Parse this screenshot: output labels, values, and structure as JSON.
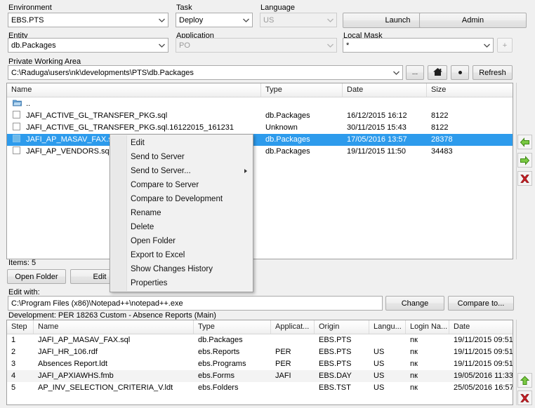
{
  "top_form": {
    "environment": {
      "label": "Environment",
      "value": "EBS.PTS"
    },
    "task": {
      "label": "Task",
      "value": "Deploy"
    },
    "language": {
      "label": "Language",
      "value": "US",
      "disabled": true
    },
    "launch_button": "Launch",
    "admin_button": "Admin",
    "entity": {
      "label": "Entity",
      "value": "db.Packages"
    },
    "application": {
      "label": "Application",
      "value": "PO",
      "disabled": true
    },
    "local_mask": {
      "label": "Local Mask",
      "value": "*"
    },
    "local_mask_add_button": "+",
    "private_working_area": {
      "label": "Private Working Area",
      "value": "C:\\Raduga\\users\\nk\\developments\\PTS\\db.Packages"
    },
    "browse_button": "...",
    "home_button": "home-icon",
    "dot_button": "•",
    "refresh_button": "Refresh"
  },
  "file_list": {
    "columns": [
      "Name",
      "Type",
      "Date",
      "Size"
    ],
    "parent_row": {
      "name": "..",
      "icon": "folder-icon"
    },
    "rows": [
      {
        "name": "JAFI_ACTIVE_GL_TRANSFER_PKG.sql",
        "type": "db.Packages",
        "date": "16/12/2015 16:12",
        "size": "8122",
        "selected": false
      },
      {
        "name": "JAFI_ACTIVE_GL_TRANSFER_PKG.sql.16122015_161231",
        "type": "Unknown",
        "date": "30/11/2015 15:43",
        "size": "8122",
        "selected": false
      },
      {
        "name": "JAFI_AP_MASAV_FAX.sql",
        "type": "db.Packages",
        "date": "17/05/2016 13:57",
        "size": "28378",
        "selected": true
      },
      {
        "name": "JAFI_AP_VENDORS.sql",
        "type": "db.Packages",
        "date": "19/11/2015 11:50",
        "size": "34483",
        "selected": false
      }
    ],
    "items_count_label": "Items: 5",
    "open_folder_button": "Open Folder",
    "edit_button": "Edit"
  },
  "context_menu": {
    "items": [
      {
        "label": "Edit",
        "submenu": false
      },
      {
        "label": "Send to Server",
        "submenu": false
      },
      {
        "label": "Send to Server...",
        "submenu": true
      },
      {
        "label": "Compare to Server",
        "submenu": false
      },
      {
        "label": "Compare to Development",
        "submenu": false
      },
      {
        "label": "Rename",
        "submenu": false
      },
      {
        "label": "Delete",
        "submenu": false
      },
      {
        "label": "Open Folder",
        "submenu": false
      },
      {
        "label": "Export to Excel",
        "submenu": false
      },
      {
        "label": "Show Changes History",
        "submenu": false
      },
      {
        "label": "Properties",
        "submenu": false
      }
    ]
  },
  "edit_with": {
    "label": "Edit with:",
    "value": "C:\\Program Files (x86)\\Notepad++\\notepad++.exe",
    "change_button": "Change",
    "compare_to_button": "Compare to..."
  },
  "development": {
    "title": "Development: PER 18263 Custom - Absence Reports (Main)",
    "columns": [
      "Step",
      "Name",
      "Type",
      "Applicat...",
      "Origin",
      "Langu...",
      "Login Na...",
      "Date"
    ],
    "rows": [
      {
        "step": "1",
        "name": "JAFI_AP_MASAV_FAX.sql",
        "type": "db.Packages",
        "application": "",
        "origin": "EBS.PTS",
        "language": "",
        "login": "nк",
        "date": "19/11/2015 09:51",
        "highlight": false
      },
      {
        "step": "2",
        "name": "JAFI_HR_106.rdf",
        "type": "ebs.Reports",
        "application": "PER",
        "origin": "EBS.PTS",
        "language": "US",
        "login": "nк",
        "date": "19/11/2015 09:51",
        "highlight": false
      },
      {
        "step": "3",
        "name": "Absences Report.ldt",
        "type": "ebs.Programs",
        "application": "PER",
        "origin": "EBS.PTS",
        "language": "US",
        "login": "nк",
        "date": "19/11/2015 09:51",
        "highlight": false
      },
      {
        "step": "4",
        "name": "JAFI_APXIAWHS.fmb",
        "type": "ebs.Forms",
        "application": "JAFI",
        "origin": "EBS.DAY",
        "language": "US",
        "login": "nк",
        "date": "19/05/2016 11:33",
        "highlight": true
      },
      {
        "step": "5",
        "name": "AP_INV_SELECTION_CRITERIA_V.ldt",
        "type": "ebs.Folders",
        "application": "",
        "origin": "EBS.TST",
        "language": "US",
        "login": "nк",
        "date": "25/05/2016 16:57",
        "highlight": false
      }
    ]
  },
  "side_buttons": {
    "list_left_arrow": "arrow-left-icon",
    "list_right_arrow": "arrow-right-icon",
    "list_delete": "delete-x-icon",
    "dev_up_arrow": "arrow-up-icon",
    "dev_delete": "delete-x-icon"
  },
  "colors": {
    "selection": "#2d9bec",
    "accent_green": "#6bbf2a",
    "accent_red": "#c9252b",
    "window_bg": "#f0f0f0"
  }
}
